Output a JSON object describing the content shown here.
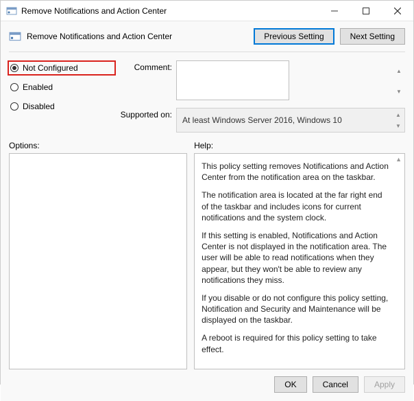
{
  "titlebar": {
    "title": "Remove Notifications and Action Center"
  },
  "header": {
    "title": "Remove Notifications and Action Center",
    "previous_btn": "Previous Setting",
    "next_btn": "Next Setting"
  },
  "radios": {
    "not_configured": "Not Configured",
    "enabled": "Enabled",
    "disabled": "Disabled",
    "selected": "not_configured"
  },
  "fields": {
    "comment_label": "Comment:",
    "comment_value": "",
    "supported_label": "Supported on:",
    "supported_value": "At least Windows Server 2016, Windows 10"
  },
  "lower": {
    "options_label": "Options:",
    "help_label": "Help:",
    "help_paragraphs": [
      "This policy setting removes Notifications and Action Center from the notification area on the taskbar.",
      "The notification area is located at the far right end of the taskbar and includes icons for current notifications and the system clock.",
      "If this setting is enabled, Notifications and Action Center is not displayed in the notification area. The user will be able to read notifications when they appear, but they won't be able to review any notifications they miss.",
      "If you disable or do not configure this policy setting, Notification and Security and Maintenance will be displayed on the taskbar.",
      "A reboot is required for this policy setting to take effect."
    ]
  },
  "footer": {
    "ok": "OK",
    "cancel": "Cancel",
    "apply": "Apply"
  }
}
